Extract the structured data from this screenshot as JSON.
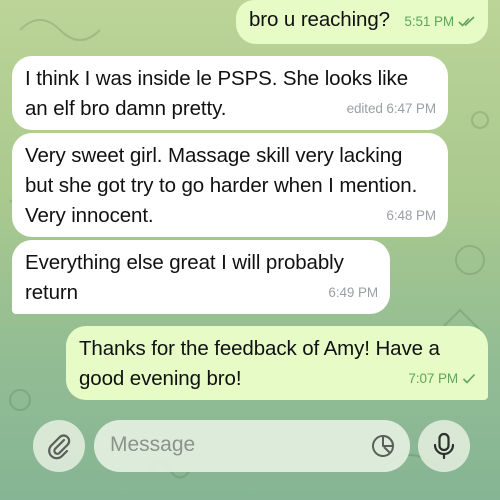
{
  "messages": [
    {
      "direction": "outgoing",
      "text": "bro u reaching?",
      "time": "5:51 PM",
      "status": "read-double-check-icon"
    },
    {
      "direction": "incoming",
      "text": "I think I was inside le PSPS. She looks like an elf bro damn pretty.",
      "time": "edited 6:47 PM"
    },
    {
      "direction": "incoming",
      "text": "Very sweet girl. Massage skill very lacking but she got try to go harder when I mention. Very innocent.",
      "time": "6:48 PM"
    },
    {
      "direction": "incoming",
      "text": "Everything else great I will probably return",
      "time": "6:49 PM"
    },
    {
      "direction": "outgoing",
      "text": "Thanks for the feedback of Amy! Have a good evening bro!",
      "time": "7:07 PM",
      "status": "sent-check-icon"
    }
  ],
  "composer": {
    "placeholder": "Message",
    "attach_icon": "paperclip-icon",
    "sticker_icon": "sticker-icon",
    "mic_icon": "microphone-icon"
  },
  "colors": {
    "incoming_bubble": "#ffffff",
    "outgoing_bubble": "#e6fbc6",
    "outgoing_meta": "#5fa55a",
    "incoming_meta": "#9aa0a6"
  }
}
